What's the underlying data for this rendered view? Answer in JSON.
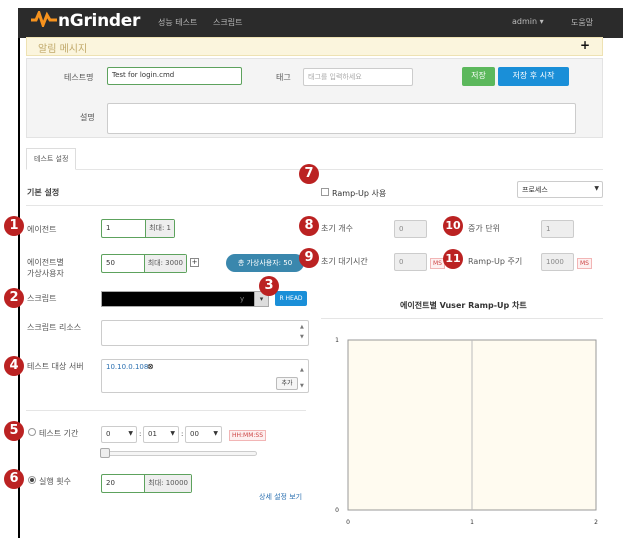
{
  "nav": {
    "logo": "nGrinder",
    "menu": [
      "성능 테스트",
      "스크립트"
    ],
    "user": "admin ▾",
    "help": "도움말"
  },
  "notice": {
    "title": "알림 메시지",
    "toggle": "+"
  },
  "test_form": {
    "name_label": "테스트명",
    "name_value": "Test for login.cmd",
    "tag_label": "태그",
    "tag_placeholder": "태그를 입력하세요",
    "save_button": "저장",
    "save_start_button": "저장 후 시작",
    "description_label": "설명"
  },
  "tabs": [
    "테스트 설정"
  ],
  "basic": {
    "heading": "기본 설정",
    "agent_label": "에이전트",
    "agent_value": "1",
    "agent_max": "최대: 1",
    "vuser_label_1": "에이전트별",
    "vuser_label_2": "가상사용자",
    "vuser_value": "50",
    "vuser_max": "최대: 3000",
    "vuser_plus": "+",
    "total_vusers": "총 가상사용자: 50",
    "script_label": "스크립트",
    "script_suffix": "y",
    "script_head_button": "R HEAD",
    "resource_label": "스크립트 리소스",
    "target_label": "테스트 대상 서버",
    "target_value": "10.10.0.108",
    "add_button": "추가",
    "duration_label": "테스트 기간",
    "duration_h": "0",
    "duration_m": "01",
    "duration_s": "00",
    "duration_format": "HH:MM:SS",
    "runcount_label": "실행 횟수",
    "runcount_value": "20",
    "runcount_max": "최대: 10000",
    "advanced_link": "상세 설정 보기"
  },
  "rampup": {
    "checkbox_label": "Ramp-Up 사용",
    "mode_select": "프로세스",
    "initial_count_label": "초기 개수",
    "initial_count_value": "0",
    "increment_label": "증가 단위",
    "increment_value": "1",
    "initial_sleep_label": "초기 대기시간",
    "initial_sleep_value": "0",
    "interval_label": "Ramp-Up 주기",
    "interval_value": "1000",
    "ms_unit": "MS"
  },
  "annotations": [
    "1",
    "2",
    "3",
    "4",
    "5",
    "6",
    "7",
    "8",
    "9",
    "10",
    "11"
  ],
  "chart_data": {
    "type": "line",
    "title": "에이전트별 Vuser Ramp-Up 차트",
    "x_ticks": [
      "0",
      "1",
      "2"
    ],
    "y_ticks": [
      "0",
      "1"
    ],
    "xlim": [
      0,
      2
    ],
    "ylim": [
      0,
      1
    ],
    "series": [],
    "grid": "vertical line at x=1",
    "background": "#fffbf0"
  },
  "colors": {
    "brand_orange": "#f7931e",
    "green_button": "#5cb85c",
    "blue_button": "#1a8fd8",
    "badge_red": "#b22222"
  }
}
